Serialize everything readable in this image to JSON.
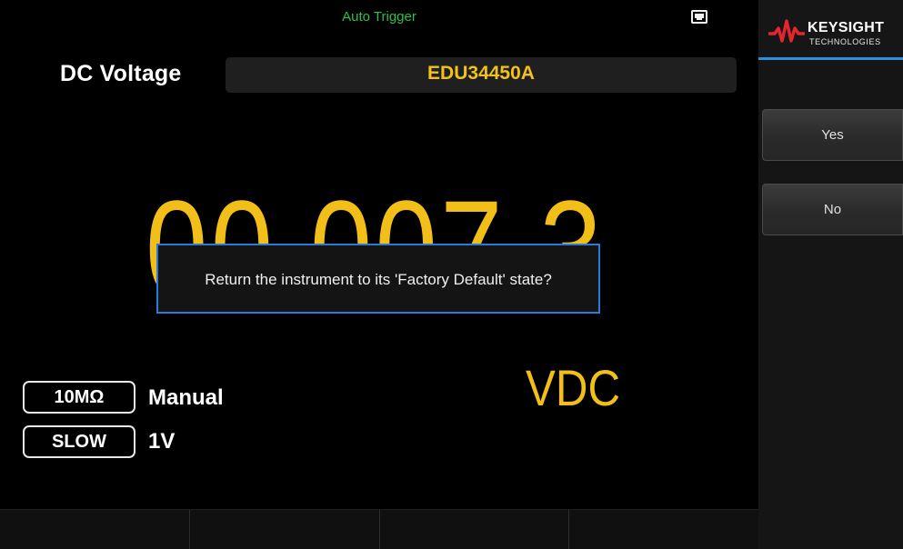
{
  "status_bar": {
    "trigger_mode": "Auto Trigger",
    "lan_icon": "lan-connected-icon"
  },
  "measurement": {
    "function": "DC Voltage",
    "model": "EDU34450A",
    "reading": "00.007 3",
    "units": "VDC"
  },
  "parameters": {
    "input_impedance": "10MΩ",
    "range_mode": "Manual",
    "speed": "SLOW",
    "range_value": "1V"
  },
  "dialog": {
    "message": "Return the instrument to its 'Factory Default' state?"
  },
  "brand": {
    "name": "KEYSIGHT",
    "subtitle": "TECHNOLOGIES",
    "logo_icon": "keysight-wave-icon"
  },
  "softkeys": {
    "yes": "Yes",
    "no": "No"
  },
  "bottom_softkeys": [
    "",
    "",
    "",
    ""
  ],
  "colors": {
    "reading": "#f2be18",
    "trigger": "#28c24c",
    "dialog_border": "#2b79d8",
    "brand_accent": "#2a8fdc",
    "logo_red": "#e8252f"
  }
}
